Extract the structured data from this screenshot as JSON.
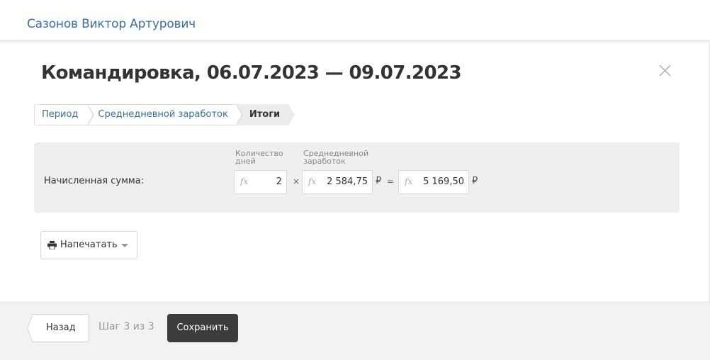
{
  "header": {
    "user_name": "Сазонов Виктор Артурович"
  },
  "dialog": {
    "title": "Командировка, 06.07.2023 — 09.07.2023",
    "close_icon": "close-icon",
    "steps": [
      {
        "label": "Период"
      },
      {
        "label": "Среднедневной заработок"
      },
      {
        "label": "Итоги"
      }
    ],
    "calc": {
      "label": "Начисленная сумма:",
      "days_label": "Количество дней",
      "days_value": "2",
      "avg_label": "Среднедневной заработок",
      "avg_value": "2 584,75",
      "total_value": "5 169,50",
      "fx_symbol": "fx",
      "multiply": "×",
      "equals": "=",
      "currency": "₽"
    },
    "print": {
      "label": "Напечатать",
      "icon": "printer-icon"
    }
  },
  "footer": {
    "back_label": "Назад",
    "step_info": "Шаг 3 из 3",
    "save_label": "Сохранить"
  },
  "colors": {
    "link": "#3a6ea5",
    "primary_button": "#3c3c3c",
    "panel_bg": "#efefef"
  }
}
